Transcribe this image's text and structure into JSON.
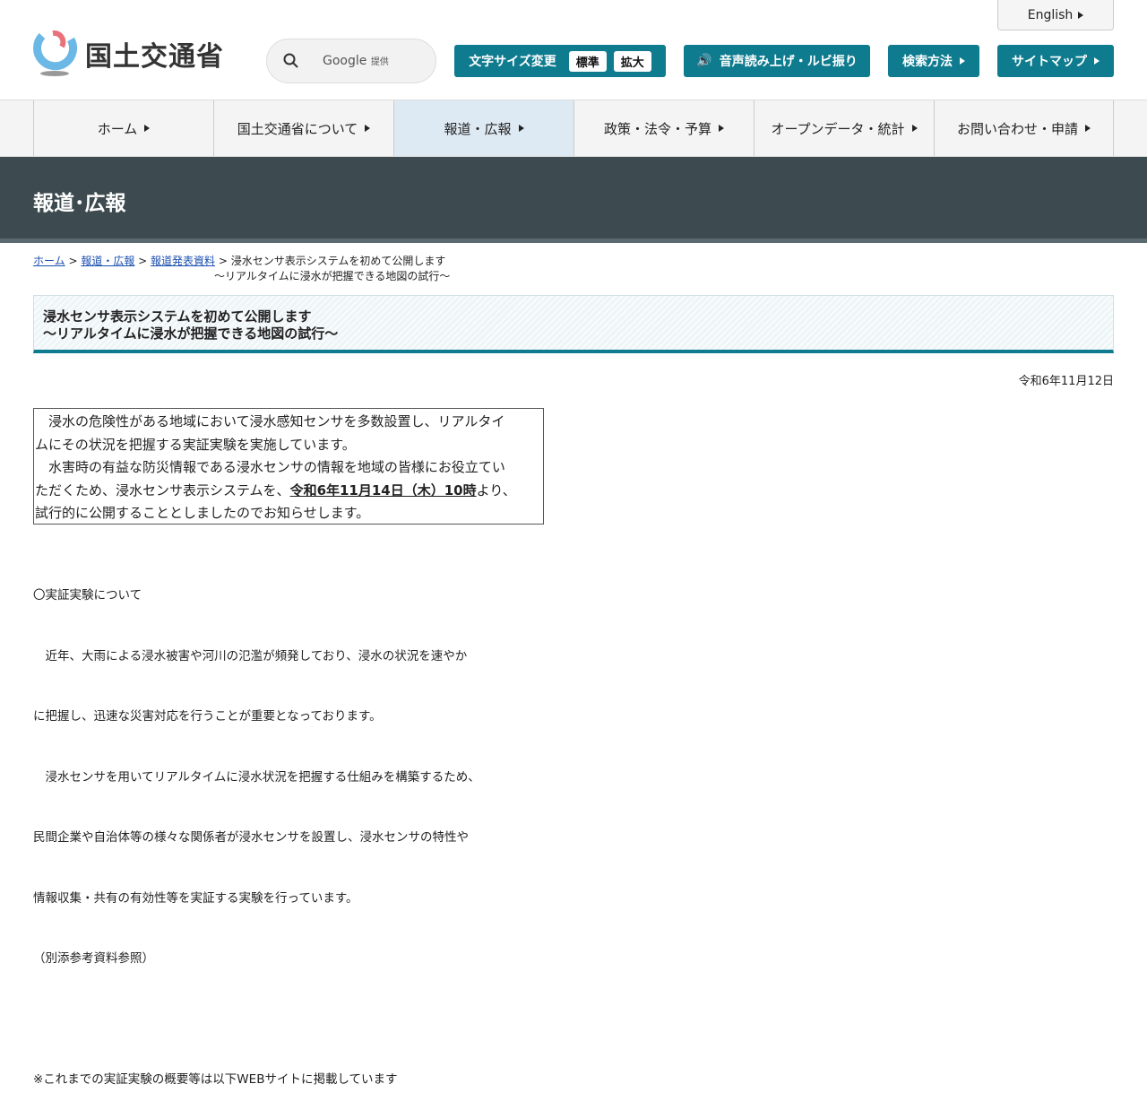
{
  "header": {
    "english": "English",
    "logo_text": "国土交通省",
    "search_provider": "Google",
    "search_provided": "提供",
    "font_size_label": "文字サイズ変更",
    "font_standard": "標準",
    "font_large": "拡大",
    "speech": "音声読み上げ・ルビ振り",
    "search_method": "検索方法",
    "sitemap": "サイトマップ"
  },
  "nav": [
    "ホーム",
    "国土交通省について",
    "報道・広報",
    "政策・法令・予算",
    "オープンデータ・統計",
    "お問い合わせ・申請"
  ],
  "banner": "報道･広報",
  "breadcrumb": {
    "home": "ホーム",
    "press": "報道・広報",
    "releases": "報道発表資料",
    "current1": "浸水センサ表示システムを初めて公開します",
    "current2": "～リアルタイムに浸水が把握できる地図の試行～"
  },
  "title": {
    "line1": "浸水センサ表示システムを初めて公開します",
    "line2": "～リアルタイムに浸水が把握できる地図の試行～"
  },
  "date": "令和6年11月12日",
  "lead": {
    "p1a": "　浸水の危険性がある地域において浸水感知センサを多数設置し、リアルタイ",
    "p1b": "ムにその状況を把握する実証実験を実施しています。",
    "p2a": "　水害時の有益な防災情報である浸水センサの情報を地域の皆様にお役立てい",
    "p2b": "ただくため、浸水センサ表示システムを、",
    "p2bold": "令和6年11月14日（木）10時",
    "p2c": "より、",
    "p2d": "試行的に公開することとしましたのでお知らせします。"
  },
  "body": [
    "〇実証実験について",
    "　近年、大雨による浸水被害や河川の氾濫が頻発しており、浸水の状況を速やか",
    "に把握し、迅速な災害対応を行うことが重要となっております。",
    "　浸水センサを用いてリアルタイムに浸水状況を把握する仕組みを構築するため、",
    "民間企業や自治体等の様々な関係者が浸水センサを設置し、浸水センサの特性や",
    "情報収集・共有の有効性等を実証する実験を行っています。",
    "（別添参考資料参照）",
    "",
    "※これまでの実証実験の概要等は以下WEBサイトに掲載しています"
  ]
}
